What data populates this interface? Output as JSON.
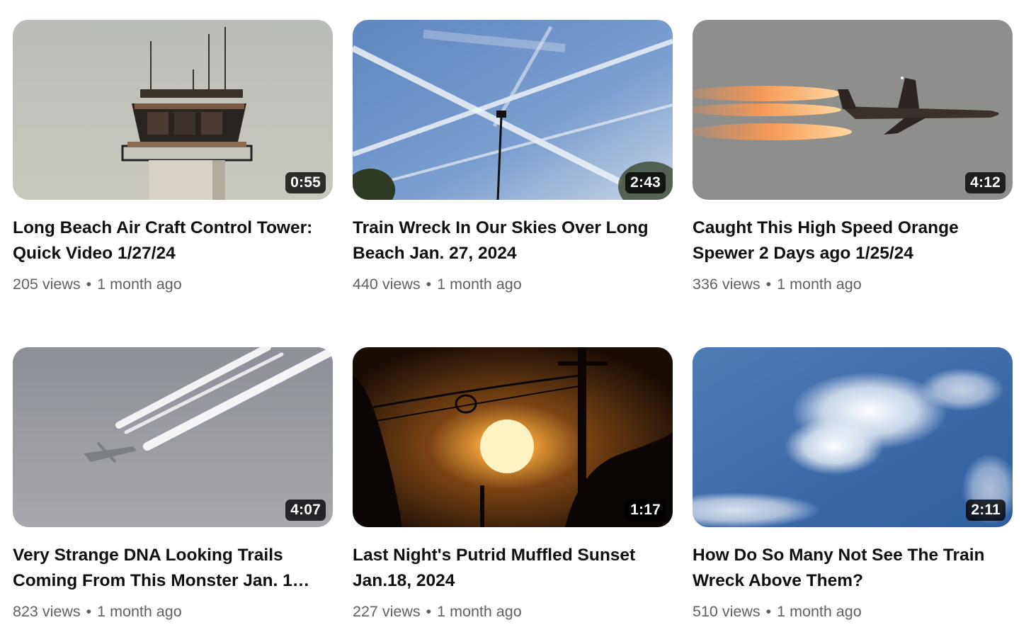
{
  "videos": [
    {
      "duration": "0:55",
      "title": "Long Beach Air Craft Control Tower: Quick Video 1/27/24",
      "views": "205 views",
      "age": "1 month ago"
    },
    {
      "duration": "2:43",
      "title": "Train Wreck In Our Skies Over Long Beach Jan. 27, 2024",
      "views": "440 views",
      "age": "1 month ago"
    },
    {
      "duration": "4:12",
      "title": "Caught This High Speed Orange Spewer 2 Days ago 1/25/24",
      "views": "336 views",
      "age": "1 month ago"
    },
    {
      "duration": "4:07",
      "title": "Very Strange DNA Looking Trails Coming From This Monster Jan. 1…",
      "views": "823 views",
      "age": "1 month ago"
    },
    {
      "duration": "1:17",
      "title": "Last Night's Putrid Muffled Sunset Jan.18, 2024",
      "views": "227 views",
      "age": "1 month ago"
    },
    {
      "duration": "2:11",
      "title": "How Do So Many Not See The Train Wreck Above Them?",
      "views": "510 views",
      "age": "1 month ago"
    }
  ],
  "separator": "•"
}
